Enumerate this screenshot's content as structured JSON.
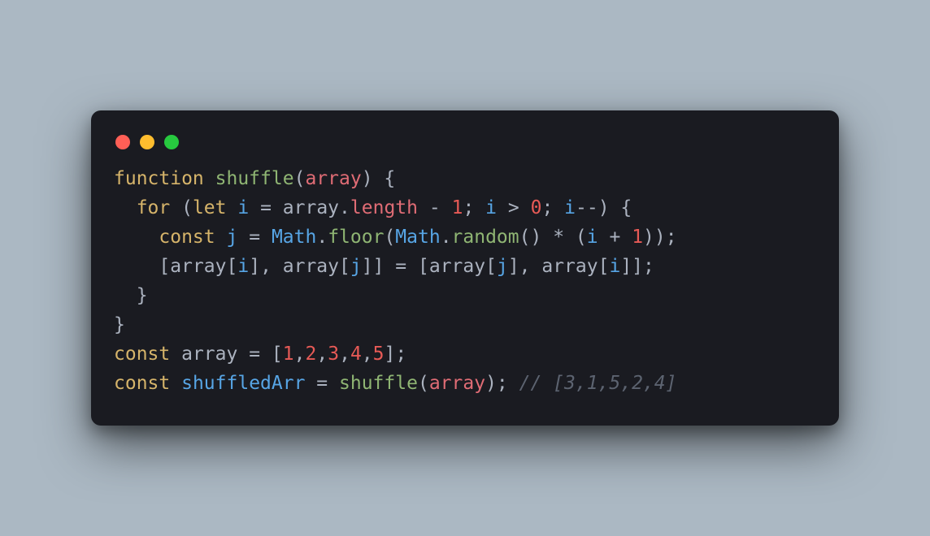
{
  "window": {
    "dots": [
      "red",
      "yellow",
      "green"
    ]
  },
  "code": {
    "lines": [
      [
        {
          "c": "kw",
          "t": "function"
        },
        {
          "c": "pun",
          "t": " "
        },
        {
          "c": "fn",
          "t": "shuffle"
        },
        {
          "c": "pun",
          "t": "("
        },
        {
          "c": "prm",
          "t": "array"
        },
        {
          "c": "pun",
          "t": ") {"
        }
      ],
      [
        {
          "c": "pun",
          "t": "  "
        },
        {
          "c": "kw",
          "t": "for"
        },
        {
          "c": "pun",
          "t": " ("
        },
        {
          "c": "kw",
          "t": "let"
        },
        {
          "c": "pun",
          "t": " "
        },
        {
          "c": "var",
          "t": "i"
        },
        {
          "c": "pun",
          "t": " "
        },
        {
          "c": "op",
          "t": "="
        },
        {
          "c": "pun",
          "t": " "
        },
        {
          "c": "id",
          "t": "array"
        },
        {
          "c": "pun",
          "t": "."
        },
        {
          "c": "prop",
          "t": "length"
        },
        {
          "c": "pun",
          "t": " "
        },
        {
          "c": "op",
          "t": "-"
        },
        {
          "c": "pun",
          "t": " "
        },
        {
          "c": "num",
          "t": "1"
        },
        {
          "c": "pun",
          "t": "; "
        },
        {
          "c": "var",
          "t": "i"
        },
        {
          "c": "pun",
          "t": " "
        },
        {
          "c": "op",
          "t": ">"
        },
        {
          "c": "pun",
          "t": " "
        },
        {
          "c": "num",
          "t": "0"
        },
        {
          "c": "pun",
          "t": "; "
        },
        {
          "c": "var",
          "t": "i"
        },
        {
          "c": "op",
          "t": "--"
        },
        {
          "c": "pun",
          "t": ") {"
        }
      ],
      [
        {
          "c": "pun",
          "t": "    "
        },
        {
          "c": "kw",
          "t": "const"
        },
        {
          "c": "pun",
          "t": " "
        },
        {
          "c": "var",
          "t": "j"
        },
        {
          "c": "pun",
          "t": " "
        },
        {
          "c": "op",
          "t": "="
        },
        {
          "c": "pun",
          "t": " "
        },
        {
          "c": "cls",
          "t": "Math"
        },
        {
          "c": "pun",
          "t": "."
        },
        {
          "c": "mth",
          "t": "floor"
        },
        {
          "c": "pun",
          "t": "("
        },
        {
          "c": "cls",
          "t": "Math"
        },
        {
          "c": "pun",
          "t": "."
        },
        {
          "c": "mth",
          "t": "random"
        },
        {
          "c": "pun",
          "t": "() "
        },
        {
          "c": "op",
          "t": "*"
        },
        {
          "c": "pun",
          "t": " ("
        },
        {
          "c": "var",
          "t": "i"
        },
        {
          "c": "pun",
          "t": " "
        },
        {
          "c": "op",
          "t": "+"
        },
        {
          "c": "pun",
          "t": " "
        },
        {
          "c": "num",
          "t": "1"
        },
        {
          "c": "pun",
          "t": "));"
        }
      ],
      [
        {
          "c": "pun",
          "t": "    ["
        },
        {
          "c": "id",
          "t": "array"
        },
        {
          "c": "pun",
          "t": "["
        },
        {
          "c": "var",
          "t": "i"
        },
        {
          "c": "pun",
          "t": "], "
        },
        {
          "c": "id",
          "t": "array"
        },
        {
          "c": "pun",
          "t": "["
        },
        {
          "c": "var",
          "t": "j"
        },
        {
          "c": "pun",
          "t": "]] "
        },
        {
          "c": "op",
          "t": "="
        },
        {
          "c": "pun",
          "t": " ["
        },
        {
          "c": "id",
          "t": "array"
        },
        {
          "c": "pun",
          "t": "["
        },
        {
          "c": "var",
          "t": "j"
        },
        {
          "c": "pun",
          "t": "], "
        },
        {
          "c": "id",
          "t": "array"
        },
        {
          "c": "pun",
          "t": "["
        },
        {
          "c": "var",
          "t": "i"
        },
        {
          "c": "pun",
          "t": "]];"
        }
      ],
      [
        {
          "c": "pun",
          "t": "  }"
        }
      ],
      [
        {
          "c": "pun",
          "t": "}"
        }
      ],
      [
        {
          "c": "kw",
          "t": "const"
        },
        {
          "c": "pun",
          "t": " "
        },
        {
          "c": "id",
          "t": "array"
        },
        {
          "c": "pun",
          "t": " "
        },
        {
          "c": "op",
          "t": "="
        },
        {
          "c": "pun",
          "t": " ["
        },
        {
          "c": "num",
          "t": "1"
        },
        {
          "c": "pun",
          "t": ","
        },
        {
          "c": "num",
          "t": "2"
        },
        {
          "c": "pun",
          "t": ","
        },
        {
          "c": "num",
          "t": "3"
        },
        {
          "c": "pun",
          "t": ","
        },
        {
          "c": "num",
          "t": "4"
        },
        {
          "c": "pun",
          "t": ","
        },
        {
          "c": "num",
          "t": "5"
        },
        {
          "c": "pun",
          "t": "];"
        }
      ],
      [
        {
          "c": "kw",
          "t": "const"
        },
        {
          "c": "pun",
          "t": " "
        },
        {
          "c": "var",
          "t": "shuffledArr"
        },
        {
          "c": "pun",
          "t": " "
        },
        {
          "c": "op",
          "t": "="
        },
        {
          "c": "pun",
          "t": " "
        },
        {
          "c": "fn",
          "t": "shuffle"
        },
        {
          "c": "pun",
          "t": "("
        },
        {
          "c": "prm",
          "t": "array"
        },
        {
          "c": "pun",
          "t": "); "
        },
        {
          "c": "cmt",
          "t": "// [3,1,5,2,4]"
        }
      ]
    ]
  }
}
